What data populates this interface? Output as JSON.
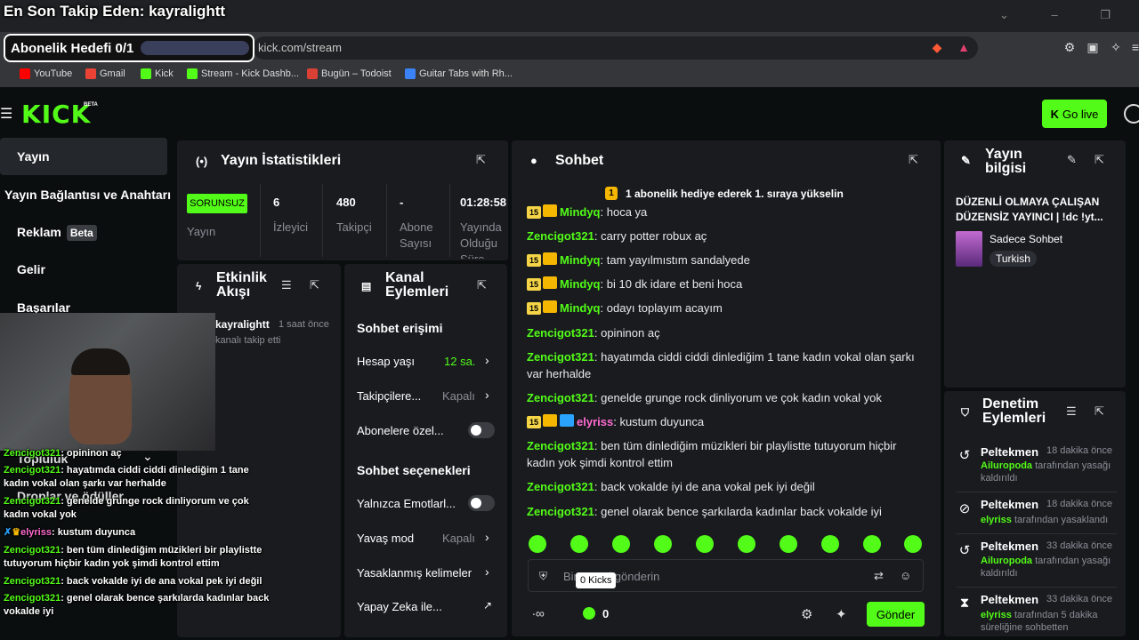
{
  "overlay": {
    "title": "En Son Takip Eden: kayralightt",
    "subscription_goal": "Abonelik Hedefi 0/1"
  },
  "browser": {
    "url": "kick.com/stream",
    "bookmarks": [
      "YouTube",
      "Gmail",
      "Kick",
      "Stream - Kick Dashb...",
      "Bugün – Todoist",
      "Guitar Tabs with Rh..."
    ]
  },
  "header": {
    "logo": "KICK",
    "logo_tag": "BETA",
    "go_live": "Go live"
  },
  "sidebar": {
    "items": [
      {
        "label": "Yayın"
      },
      {
        "label": "Yayın Bağlantısı ve Anahtarı"
      },
      {
        "label": "Reklam",
        "badge": "Beta"
      },
      {
        "label": "Gelir"
      },
      {
        "label": "Başarılar"
      },
      {
        "label": "Topluluk"
      },
      {
        "label": "Droplar ve ödüller"
      }
    ]
  },
  "stats": {
    "title": "Yayın İstatistikleri",
    "status": "SORUNSUZ",
    "status_label": "Yayın",
    "viewers": "6",
    "viewers_label": "İzleyici",
    "followers": "480",
    "followers_label": "Takipçi",
    "subs": "-",
    "subs_label": "Abone Sayısı",
    "uptime": "01:28:58",
    "uptime_label": "Yayında Olduğu Süre"
  },
  "activity": {
    "title": "Etkinlik Akışı",
    "items": [
      {
        "user": "kayralightt",
        "time": "1 saat önce",
        "text": "kanalı takip etti"
      }
    ]
  },
  "channel_actions": {
    "title": "Kanal Eylemleri",
    "chat_access": "Sohbet erişimi",
    "account_age": "Hesap yaşı",
    "account_age_val": "12 sa.",
    "followers_only": "Takipçilere...",
    "followers_only_val": "Kapalı",
    "subs_only": "Abonelere özel...",
    "chat_options": "Sohbet seçenekleri",
    "emotes_only": "Yalnızca Emotlarl...",
    "slow_mode": "Yavaş mod",
    "slow_mode_val": "Kapalı",
    "banned_words": "Yasaklanmış kelimeler",
    "ai": "Yapay Zeka ile..."
  },
  "chat": {
    "title": "Sohbet",
    "banner": "1 abonelik hediye ederek 1. sıraya yükselin",
    "messages": [
      {
        "user": "Mindyq",
        "badge": "15",
        "text": "hoca ya"
      },
      {
        "user": "Zencigot321",
        "text": "carry potter robux aç"
      },
      {
        "user": "Mindyq",
        "badge": "15",
        "text": "tam yayılmıstım sandalyede"
      },
      {
        "user": "Mindyq",
        "badge": "15",
        "text": "bi 10 dk idare et beni hoca"
      },
      {
        "user": "Mindyq",
        "badge": "15",
        "text": "odayı toplayım acayım"
      },
      {
        "user": "Zencigot321",
        "text": "opininon aç"
      },
      {
        "user": "Zencigot321",
        "text": "hayatımda ciddi ciddi dinlediğim 1 tane kadın vokal olan şarkı var herhalde"
      },
      {
        "user": "Zencigot321",
        "text": "genelde grunge rock dinliyorum ve çok kadın vokal yok"
      },
      {
        "user": "elyriss",
        "badge": "15",
        "text": "kustum duyunca"
      },
      {
        "user": "Zencigot321",
        "text": "ben tüm dinlediğim müzikleri bir playlistte tutuyorum hiçbir kadın yok şimdi kontrol ettim"
      },
      {
        "user": "Zencigot321",
        "text": "back vokalde iyi de ana vokal pek iyi değil"
      },
      {
        "user": "Zencigot321",
        "text": "genel olarak bence şarkılarda kadınlar back vokalde iyi"
      }
    ],
    "input_placeholder": "Bir mesaj gönderin",
    "kicks_tooltip": "0 Kicks",
    "kicks_count": "0",
    "send": "Gönder"
  },
  "stream_info": {
    "title": "Yayın bilgisi",
    "stream_title": "DÜZENLİ OLMAYA ÇALIŞAN DÜZENSİZ YAYINCI | !dc !yt...",
    "category": "Sadece Sohbet",
    "language": "Turkish"
  },
  "moderation": {
    "title": "Denetim Eylemleri",
    "items": [
      {
        "user": "Peltekmen",
        "time": "18 dakika önce",
        "target": "Ailuropoda",
        "text": "tarafından yasağı kaldırıldı"
      },
      {
        "user": "Peltekmen",
        "time": "18 dakika önce",
        "target": "elyriss",
        "text": "tarafından yasaklandı"
      },
      {
        "user": "Peltekmen",
        "time": "33 dakika önce",
        "target": "Ailuropoda",
        "text": "tarafından yasağı kaldırıldı"
      },
      {
        "user": "Peltekmen",
        "time": "33 dakika önce",
        "target": "elyriss",
        "text": "tarafından 5 dakika süreliğine sohbetten"
      }
    ]
  },
  "overlay_chat": [
    {
      "user": "Zencigot321",
      "text": "opininon aç"
    },
    {
      "user": "Zencigot321",
      "text": "hayatımda ciddi ciddi dinlediğim 1 tane kadın vokal olan şarkı var herhalde"
    },
    {
      "user": "Zencigot321",
      "text": "genelde grunge rock dinliyorum ve çok kadın vokal yok"
    },
    {
      "user": "elyriss",
      "text": "kustum duyunca"
    },
    {
      "user": "Zencigot321",
      "text": "ben tüm dinlediğim müzikleri bir playlistte tutuyorum hiçbir kadın yok şimdi kontrol ettim"
    },
    {
      "user": "Zencigot321",
      "text": "back vokalde iyi de ana vokal pek iyi değil"
    },
    {
      "user": "Zencigot321",
      "text": "genel olarak bence şarkılarda kadınlar back vokalde iyi"
    }
  ],
  "colors": {
    "brand": "#53fc18",
    "bg": "#0b0e0f",
    "panel": "#191b1f",
    "badge": "#f5d547",
    "pink": "#ff6bd0"
  }
}
